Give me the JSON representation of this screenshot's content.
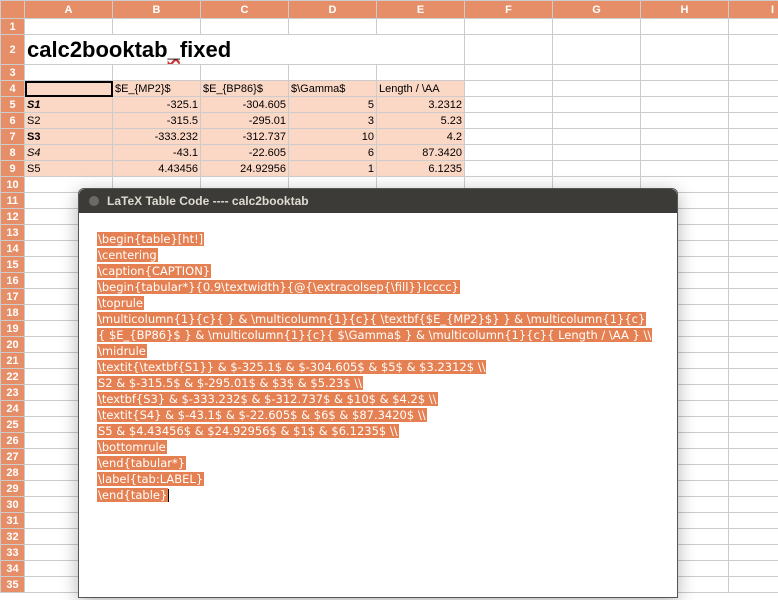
{
  "columns": [
    "A",
    "B",
    "C",
    "D",
    "E",
    "F",
    "G",
    "H",
    "I"
  ],
  "row_count": 35,
  "title_text": "calc2booktab_fixed",
  "header_row": {
    "b": "$E_{MP2}$",
    "c": "$E_{BP86}$",
    "d": "$\\Gamma$",
    "e": "Length / \\AA"
  },
  "rows": [
    {
      "a": "S1",
      "b": "-325.1",
      "c": "-304.605",
      "d": "5",
      "e": "3.2312",
      "a_bold": true,
      "a_ital": true
    },
    {
      "a": "S2",
      "b": "-315.5",
      "c": "-295.01",
      "d": "3",
      "e": "5.23"
    },
    {
      "a": "S3",
      "b": "-333.232",
      "c": "-312.737",
      "d": "10",
      "e": "4.2",
      "a_bold": true
    },
    {
      "a": "S4",
      "b": "-43.1",
      "c": "-22.605",
      "d": "6",
      "e": "87.3420",
      "a_ital": true
    },
    {
      "a": "S5",
      "b": "4.43456",
      "c": "24.92956",
      "d": "1",
      "e": "6.1235"
    }
  ],
  "dialog": {
    "title": "LaTeX Table Code ---- calc2booktab",
    "lines": [
      "\\begin{table}[ht!]",
      "\\centering",
      "\\caption{CAPTION}",
      "\\begin{tabular*}{0.9\\textwidth}{@{\\extracolsep{\\fill}}lcccc}",
      "\\toprule",
      "\\multicolumn{1}{c}{  } & \\multicolumn{1}{c}{ \\textbf{$E_{MP2}$} } & \\multicolumn{1}{c}",
      "{ $E_{BP86}$ } & \\multicolumn{1}{c}{ $\\Gamma$ } & \\multicolumn{1}{c}{ Length / \\AA } \\\\",
      "\\midrule",
      "\\textit{\\textbf{S1}} & $-325.1$ & $-304.605$ & $5$ & $3.2312$ \\\\",
      "S2 & $-315.5$ & $-295.01$ & $3$ & $5.23$ \\\\",
      "\\textbf{S3} & $-333.232$ & $-312.737$ & $10$ & $4.2$ \\\\",
      "\\textit{S4} & $-43.1$ & $-22.605$ & $6$ & $87.3420$ \\\\",
      "S5 & $4.43456$ & $24.92956$ & $1$ & $6.1235$ \\\\",
      "\\bottomrule",
      "\\end{tabular*}",
      "\\label{tab:LABEL}",
      "\\end{table}"
    ]
  }
}
